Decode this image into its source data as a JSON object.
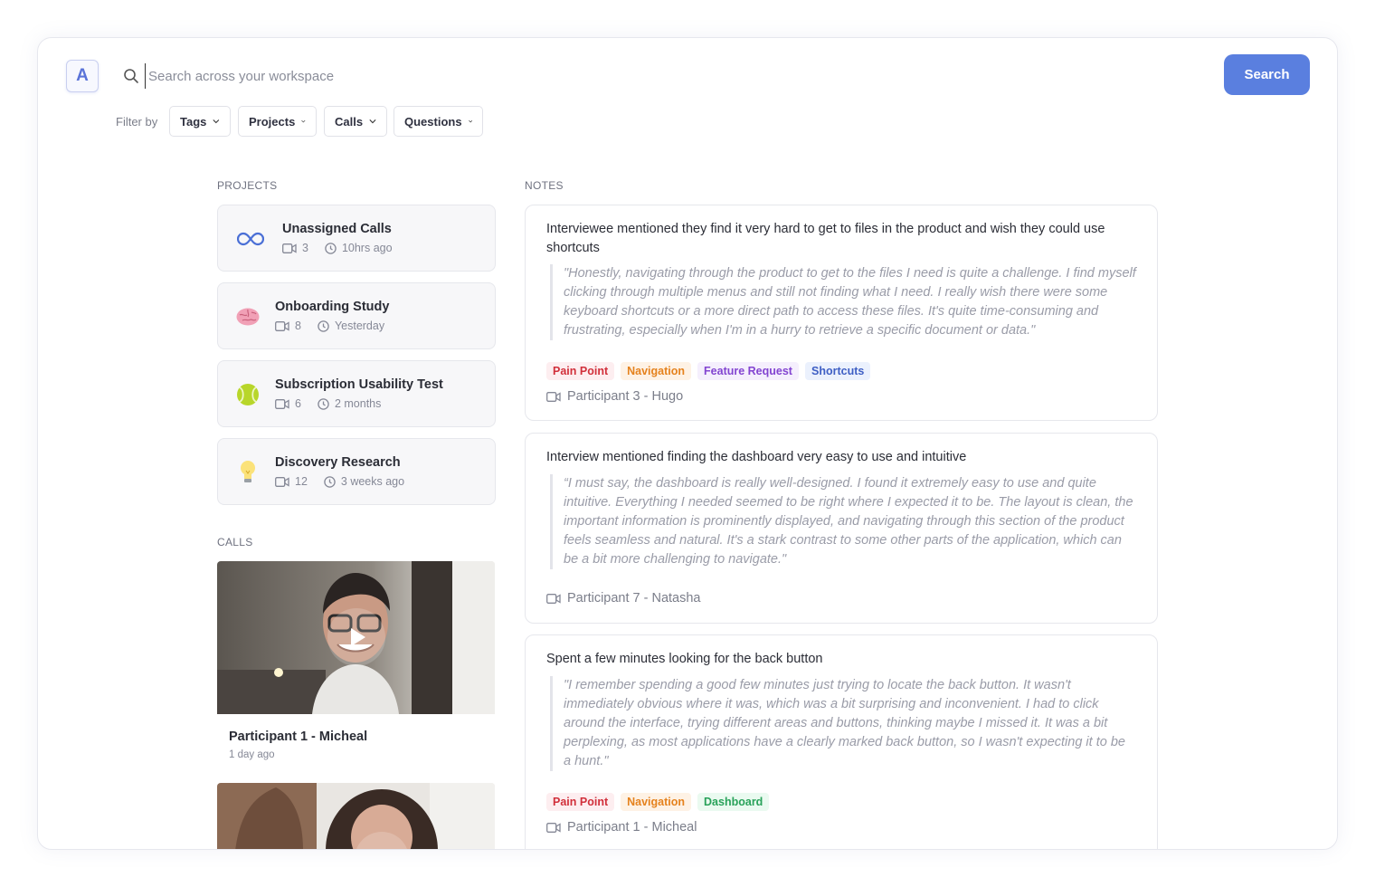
{
  "header": {
    "logo_letter": "A",
    "search_placeholder": "Search across your workspace",
    "search_value": "",
    "search_button": "Search"
  },
  "filters": {
    "label": "Filter by",
    "items": [
      {
        "label": "Tags"
      },
      {
        "label": "Projects"
      },
      {
        "label": "Calls"
      },
      {
        "label": "Questions"
      }
    ]
  },
  "projects": {
    "heading": "PROJECTS",
    "items": [
      {
        "icon": "infinity-icon",
        "title": "Unassigned Calls",
        "calls": "3",
        "time": "10hrs ago"
      },
      {
        "icon": "brain-icon",
        "title": "Onboarding Study",
        "calls": "8",
        "time": "Yesterday"
      },
      {
        "icon": "tennis-ball-icon",
        "title": "Subscription Usability Test",
        "calls": "6",
        "time": "2 months"
      },
      {
        "icon": "lightbulb-icon",
        "title": "Discovery Research",
        "calls": "12",
        "time": "3 weeks ago"
      }
    ]
  },
  "calls": {
    "heading": "CALLS",
    "items": [
      {
        "title": "Participant 1 - Micheal",
        "time": "1 day ago"
      }
    ]
  },
  "notes": {
    "heading": "NOTES",
    "items": [
      {
        "title": "Interviewee mentioned they find it very hard to get to files in the product and wish they could use shortcuts",
        "quote": "\"Honestly, navigating through the product to get to the files I need is quite a challenge. I find myself clicking through multiple menus and still not finding what I need. I really wish there were some keyboard shortcuts or a more direct path to access these files. It's quite time-consuming and frustrating, especially when I'm in a hurry to retrieve a specific document or data.\"",
        "tags": [
          {
            "label": "Pain Point",
            "color": "#d1303b"
          },
          {
            "label": "Navigation",
            "color": "#e5821d"
          },
          {
            "label": "Feature Request",
            "color": "#8345d1"
          },
          {
            "label": "Shortcuts",
            "color": "#3e5fc4"
          }
        ],
        "participant": "Participant 3 - Hugo"
      },
      {
        "title": "Interview mentioned finding the dashboard very easy to use and intuitive",
        "quote": "“I must say, the dashboard is really well-designed. I found it extremely easy to use and quite intuitive. Everything I needed seemed to be right where I expected it to be. The layout is clean, the important information is prominently displayed, and navigating through this section of the product feels seamless and natural. It's a stark contrast to some other parts of the application, which can be a bit more challenging to navigate.\"",
        "tags": [],
        "participant": "Participant 7 - Natasha"
      },
      {
        "title": "Spent a few minutes looking for the back button",
        "quote": "\"I remember spending a good few minutes just trying to locate the back button. It wasn't immediately obvious where it was, which was a bit surprising and inconvenient. I had to click around the interface, trying different areas and buttons, thinking maybe I missed it. It was a bit perplexing, as most applications have a clearly marked back button, so I wasn't expecting it to be a hunt.\"",
        "tags": [
          {
            "label": "Pain Point",
            "color": "#d1303b"
          },
          {
            "label": "Navigation",
            "color": "#e5821d"
          },
          {
            "label": "Dashboard",
            "color": "#29a25a"
          }
        ],
        "participant": "Participant 1 - Micheal"
      }
    ]
  },
  "colors": {
    "accent": "#5a7fdf"
  }
}
